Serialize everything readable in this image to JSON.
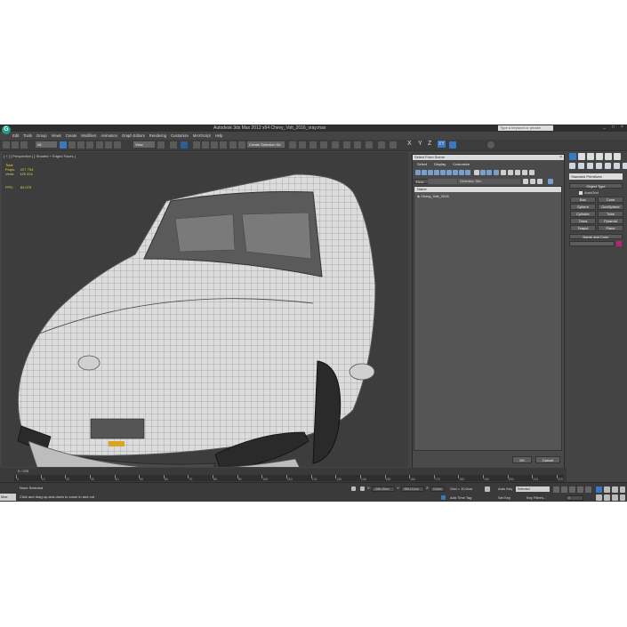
{
  "window": {
    "title": "Autodesk 3ds Max 2012 x64    Chevy_Volt_2016_vray.max",
    "search_placeholder": "Type a keyword or phrase"
  },
  "menu": [
    "Edit",
    "Tools",
    "Group",
    "Views",
    "Create",
    "Modifiers",
    "Animation",
    "Graph Editors",
    "Rendering",
    "Customize",
    "MAXScript",
    "Help"
  ],
  "toolbar": {
    "selection_filter": "All",
    "reference_coord": "View",
    "named_selection": "Create Selection Se",
    "axes": [
      "X",
      "Y",
      "Z",
      "XY"
    ],
    "axis_active": "XY"
  },
  "viewport": {
    "label": "[ + ] [ Perspective ] [ Shaded + Edged Faces ]",
    "stats": [
      {
        "label": "Total",
        "value": ""
      },
      {
        "label": "Polys:",
        "value": "227 704"
      },
      {
        "label": "Verts:",
        "value": "129 224"
      }
    ],
    "fps_label": "FPS:",
    "fps_value": "84,075"
  },
  "dialog": {
    "title": "Select From Scene",
    "menu": [
      "Select",
      "Display",
      "Customize"
    ],
    "find_label": "Find:",
    "selection_set_label": "Selection Set:",
    "column_header": "Name",
    "items": [
      "Chevy_Volt_2016"
    ],
    "ok_label": "OK",
    "cancel_label": "Cancel"
  },
  "command_panel": {
    "category": "Standard Primitives",
    "object_type_label": "Object Type",
    "autogrid_label": "AutoGrid",
    "primitives": [
      "Box",
      "Cone",
      "Sphere",
      "GeoSphere",
      "Cylinder",
      "Tube",
      "Torus",
      "Pyramid",
      "Teapot",
      "Plane"
    ],
    "name_color_label": "Name and Color",
    "color": "#c21f7a"
  },
  "timeline": {
    "frame_counter": "0 / 225",
    "ticks": [
      "0",
      "10",
      "20",
      "30",
      "40",
      "50",
      "60",
      "70",
      "80",
      "90",
      "100",
      "110",
      "120",
      "130",
      "140",
      "150",
      "160",
      "170",
      "180",
      "190",
      "200",
      "210",
      "220"
    ]
  },
  "status": {
    "maxscript_label": "Max",
    "selection_status": "None Selected",
    "prompt": "Click and drag up-and-down to zoom in and out",
    "x_label": "X:",
    "x_value": "-266,49cm",
    "y_label": "Y:",
    "y_value": "385,111cm",
    "z_label": "Z:",
    "z_value": "0,0cm",
    "grid": "Grid = 10,0cm",
    "add_time_tag": "Add Time Tag",
    "auto_key": "Auto Key",
    "set_key": "Set Key",
    "key_mode": "Selected",
    "key_filters": "Key Filters...",
    "current_frame": "0"
  }
}
